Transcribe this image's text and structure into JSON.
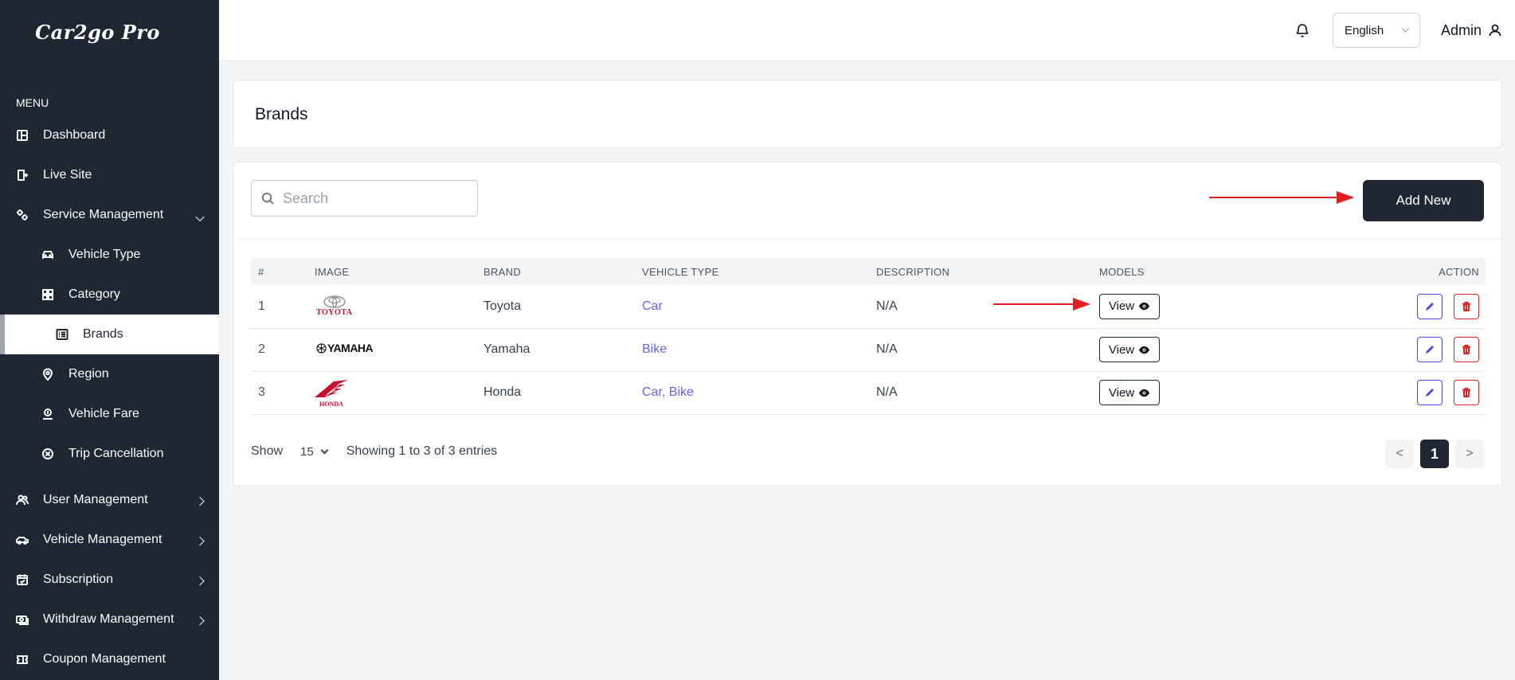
{
  "brand": {
    "logo_text": "Car2go Pro"
  },
  "sidebar": {
    "menu_title": "MENU",
    "items": [
      {
        "label": "Dashboard"
      },
      {
        "label": "Live Site"
      },
      {
        "label": "Service Management"
      },
      {
        "label": "Vehicle Type"
      },
      {
        "label": "Category"
      },
      {
        "label": "Brands"
      },
      {
        "label": "Region"
      },
      {
        "label": "Vehicle Fare"
      },
      {
        "label": "Trip Cancellation"
      },
      {
        "label": "User Management"
      },
      {
        "label": "Vehicle Management"
      },
      {
        "label": "Subscription"
      },
      {
        "label": "Withdraw Management"
      },
      {
        "label": "Coupon Management"
      }
    ]
  },
  "header": {
    "language": "English",
    "user": "Admin"
  },
  "page": {
    "title": "Brands"
  },
  "toolbar": {
    "search_placeholder": "Search",
    "add_label": "Add New"
  },
  "table": {
    "columns": [
      "#",
      "IMAGE",
      "BRAND",
      "VEHICLE TYPE",
      "DESCRIPTION",
      "MODELS",
      "ACTION"
    ],
    "rows": [
      {
        "index": "1",
        "logo_text": "TOYOTA",
        "brand": "Toyota",
        "vehicle_type": "Car",
        "description": "N/A",
        "models_label": "View"
      },
      {
        "index": "2",
        "logo_text": "YAMAHA",
        "brand": "Yamaha",
        "vehicle_type": "Bike",
        "description": "N/A",
        "models_label": "View"
      },
      {
        "index": "3",
        "logo_text": "HONDA",
        "brand": "Honda",
        "vehicle_type": "Car, Bike",
        "description": "N/A",
        "models_label": "View"
      }
    ]
  },
  "footer": {
    "show_label": "Show",
    "per_page": "15",
    "entries_text": "Showing 1 to 3 of 3 entries",
    "pagination": {
      "prev": "<",
      "current": "1",
      "next": ">"
    }
  },
  "colors": {
    "sidebar_bg": "#1f2732",
    "accent_link": "#6366f1",
    "delete": "#dc2626",
    "edit": "#4f46e5",
    "annotation": "#e11d1d"
  }
}
